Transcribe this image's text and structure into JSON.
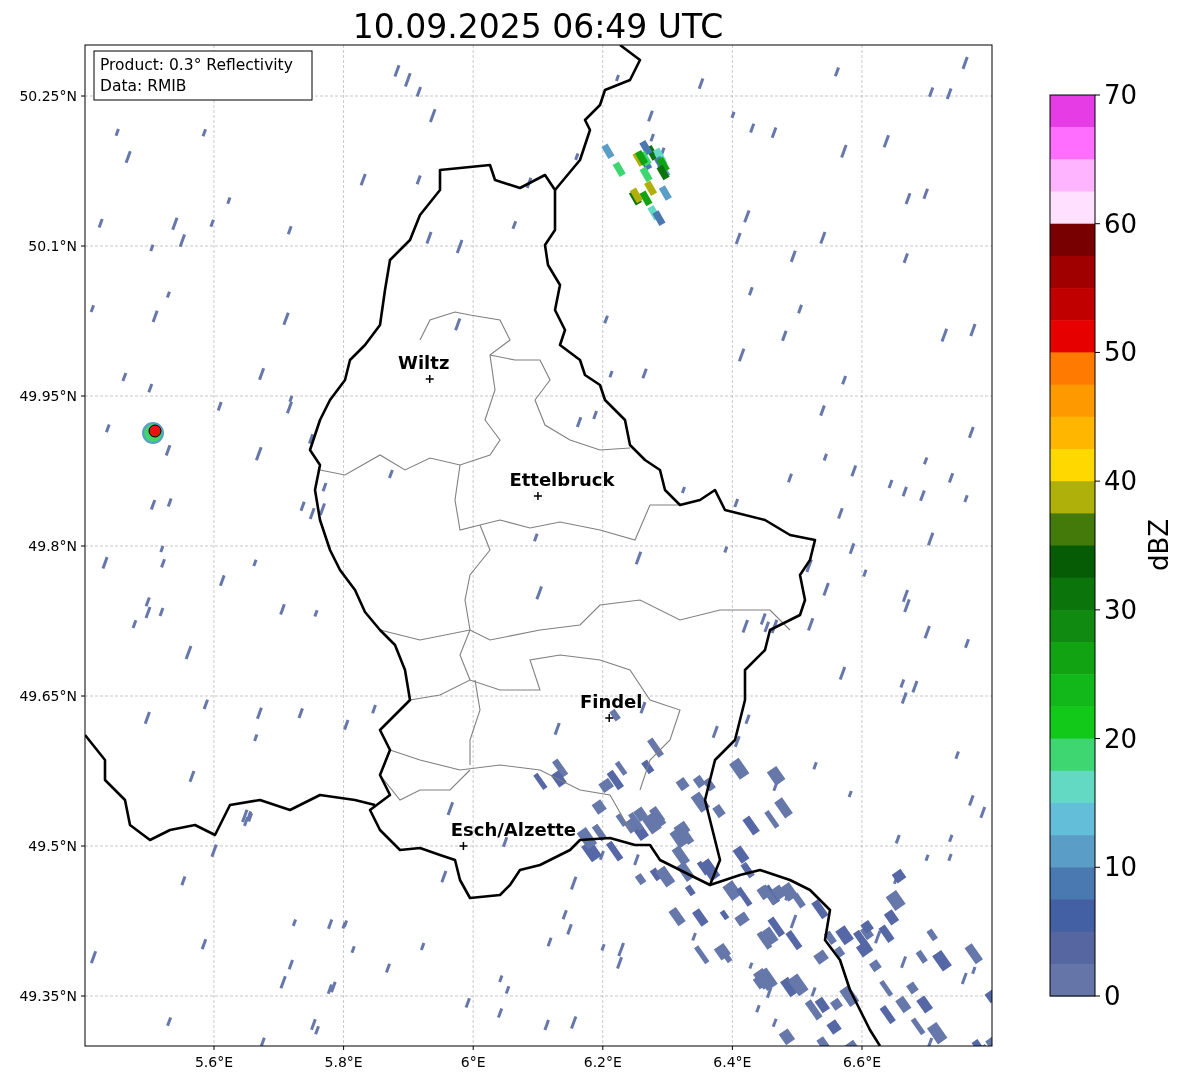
{
  "title": "10.09.2025 06:49 UTC",
  "legend": {
    "lines": [
      "Product: 0.3° Reflectivity",
      "Data: RMIB"
    ]
  },
  "map": {
    "y_ticks": [
      "50.25°N",
      "50.1°N",
      "49.95°N",
      "49.8°N",
      "49.65°N",
      "49.5°N",
      "49.35°N"
    ],
    "x_ticks": [
      "5.6°E",
      "5.8°E",
      "6°E",
      "6.2°E",
      "6.4°E",
      "6.6°E"
    ],
    "cities": [
      {
        "name": "Wiltz"
      },
      {
        "name": "Ettelbruck"
      },
      {
        "name": "Findel"
      },
      {
        "name": "Esch/Alzette"
      }
    ],
    "radar_site": {
      "color": "#ee1111"
    }
  },
  "colorbar": {
    "label": "dBZ",
    "ticks": [
      "70",
      "60",
      "50",
      "40",
      "30",
      "20",
      "10",
      "0"
    ],
    "segments": [
      {
        "color": "#e63ce6"
      },
      {
        "color": "#ff6eff"
      },
      {
        "color": "#ffb4ff"
      },
      {
        "color": "#ffe0ff"
      },
      {
        "color": "#780000"
      },
      {
        "color": "#a00000"
      },
      {
        "color": "#c00000"
      },
      {
        "color": "#e60000"
      },
      {
        "color": "#ff7a00"
      },
      {
        "color": "#ff9900"
      },
      {
        "color": "#ffb600"
      },
      {
        "color": "#ffd800"
      },
      {
        "color": "#b0b00a"
      },
      {
        "color": "#437a0a"
      },
      {
        "color": "#055c05"
      },
      {
        "color": "#0b740b"
      },
      {
        "color": "#108a10"
      },
      {
        "color": "#12a312"
      },
      {
        "color": "#12b81a"
      },
      {
        "color": "#12c91a"
      },
      {
        "color": "#3dd670"
      },
      {
        "color": "#63d9c4"
      },
      {
        "color": "#63bfd9"
      },
      {
        "color": "#5a9ec8"
      },
      {
        "color": "#4a78b0"
      },
      {
        "color": "#4460a5"
      },
      {
        "color": "#5666a0"
      },
      {
        "color": "#6675a8"
      }
    ]
  }
}
